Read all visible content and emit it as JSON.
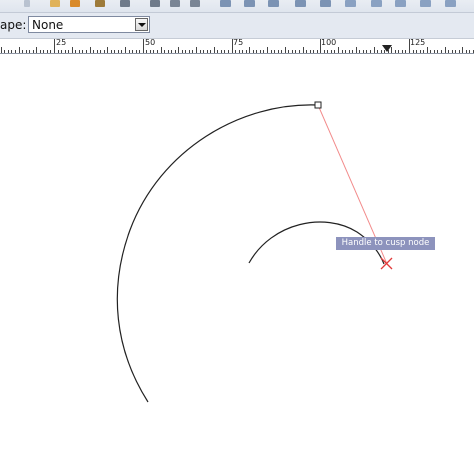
{
  "tool_controls": {
    "shape_label": "ape:",
    "shape_value": "None"
  },
  "ruler": {
    "labels": [
      "25",
      "50",
      "75",
      "100",
      "125"
    ]
  },
  "canvas": {
    "tooltip": "Handle to cusp node"
  },
  "colors": {
    "path_stroke": "#222222",
    "handle_line": "#f28b8b",
    "cusp_marker": "#e23a3a",
    "tooltip_bg": "#8d93bd"
  }
}
